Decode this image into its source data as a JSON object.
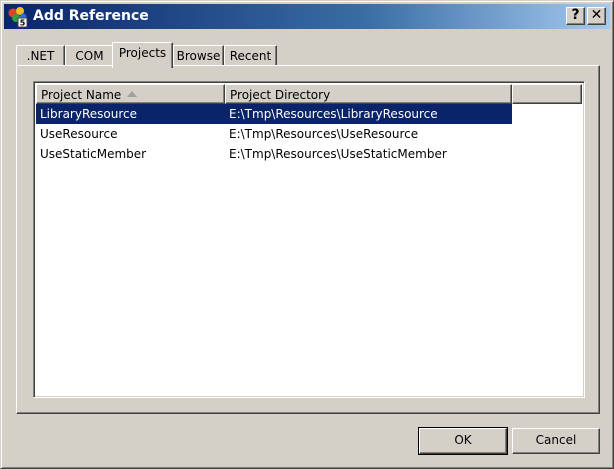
{
  "window": {
    "title": "Add Reference",
    "help_label": "?",
    "close_label": "✕"
  },
  "tabs": [
    {
      "label": ".NET",
      "active": false
    },
    {
      "label": "COM",
      "active": false
    },
    {
      "label": "Projects",
      "active": true
    },
    {
      "label": "Browse",
      "active": false
    },
    {
      "label": "Recent",
      "active": false
    }
  ],
  "list": {
    "columns": [
      {
        "label": "Project Name",
        "sort": "ascending"
      },
      {
        "label": "Project Directory"
      }
    ],
    "rows": [
      {
        "name": "LibraryResource",
        "directory": "E:\\Tmp\\Resources\\LibraryResource",
        "selected": true
      },
      {
        "name": "UseResource",
        "directory": "E:\\Tmp\\Resources\\UseResource",
        "selected": false
      },
      {
        "name": "UseStaticMember",
        "directory": "E:\\Tmp\\Resources\\UseStaticMember",
        "selected": false
      }
    ]
  },
  "buttons": {
    "ok_label": "OK",
    "cancel_label": "Cancel"
  },
  "colors": {
    "titlebar_start": "#0a246a",
    "titlebar_end": "#a6caf0",
    "selection": "#0a246a",
    "face": "#d4d0c8"
  },
  "icons": {
    "app": "visual-studio-icon",
    "sort": "sort-ascending-icon"
  }
}
